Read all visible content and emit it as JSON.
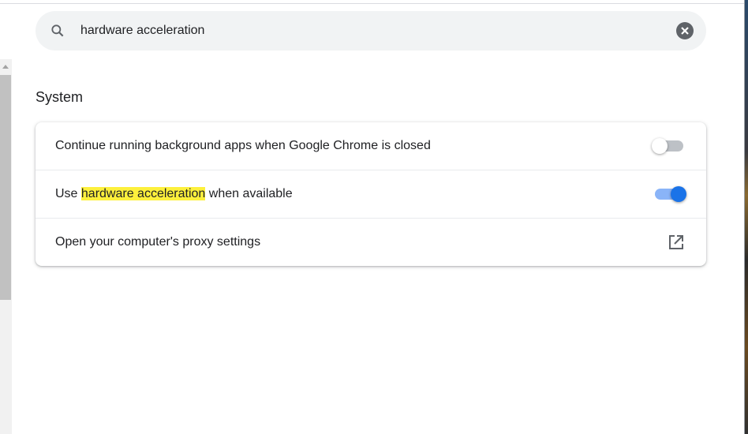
{
  "search": {
    "query": "hardware acceleration",
    "icon": "search-icon",
    "clear_icon": "clear-icon"
  },
  "section": {
    "title": "System"
  },
  "settings": [
    {
      "label": "Continue running background apps when Google Chrome is closed",
      "control": "toggle",
      "enabled": false
    },
    {
      "label_prefix": "Use ",
      "label_highlight": "hardware acceleration",
      "label_suffix": " when available",
      "control": "toggle",
      "enabled": true
    },
    {
      "label": "Open your computer's proxy settings",
      "control": "external-link"
    }
  ],
  "colors": {
    "accent": "#1a73e8",
    "highlight": "#fdf03c"
  }
}
